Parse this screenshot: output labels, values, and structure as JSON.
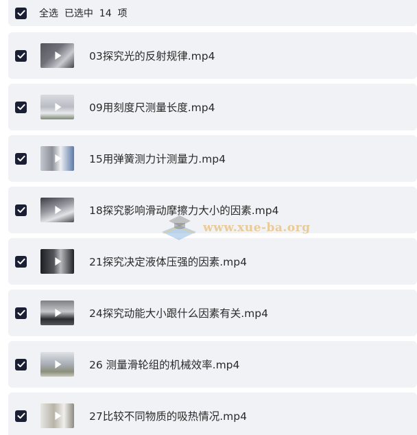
{
  "header": {
    "select_all_text": "全选  已选中  14  项"
  },
  "files": [
    {
      "name": "03探究光的反射规律.mp4"
    },
    {
      "name": "09用刻度尺测量长度.mp4"
    },
    {
      "name": "15用弹簧测力计测量力.mp4"
    },
    {
      "name": "18探究影响滑动摩擦力大小的因素.mp4"
    },
    {
      "name": "21探究决定液体压强的因素.mp4"
    },
    {
      "name": "24探究动能大小跟什么因素有关.mp4"
    },
    {
      "name": "26 测量滑轮组的机械效率.mp4"
    },
    {
      "name": "27比较不同物质的吸热情况.mp4"
    }
  ],
  "watermark": {
    "text": "www.xue-ba.org"
  },
  "icons": {
    "checkbox": "checkbox-checked-icon",
    "play": "play-icon",
    "watermark_logo": "graduation-cap-book-icon"
  },
  "colors": {
    "checkbox_fill": "#1a1f33",
    "row_background": "#f1f2f5",
    "watermark": "#e6be78"
  }
}
